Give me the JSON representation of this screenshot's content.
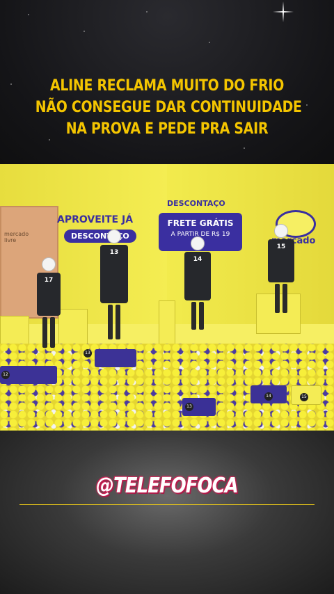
{
  "headline": {
    "lines": [
      "ALINE RECLAMA MUITO DO FRIO",
      "NÃO CONSEGUE DAR CONTINUIDADE",
      "NA PROVA E PEDE PRA SAIR"
    ],
    "color": "#f4c500"
  },
  "video": {
    "signs": {
      "mercado_livre_small": "mercado\nlivre",
      "aproveite": "APROVEITE JÁ",
      "descontaco_badge": "DESCONTAÇO",
      "descontaco_title": "DESCONTAÇO",
      "frete_gratis": "FRETE GRÁTIS",
      "a_partir": "A PARTIR DE R$ 19",
      "mercado_livre_logo": "mercado\nlivre"
    },
    "jersey_numbers": [
      "17",
      "13",
      "14",
      "15"
    ],
    "pedestal_numbers": [
      "12",
      "13",
      "13",
      "14",
      "15"
    ]
  },
  "watermark": {
    "handle": "@TELEFOFOCA",
    "accent": "#d8245a",
    "rule_color": "#e2c21a"
  }
}
